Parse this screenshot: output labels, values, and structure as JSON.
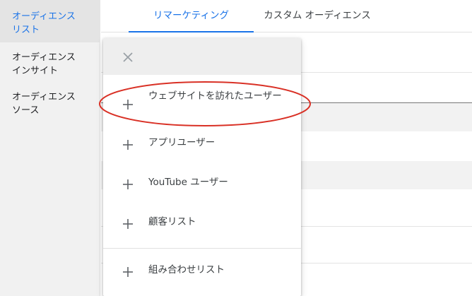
{
  "sidebar": {
    "items": [
      {
        "lines": [
          "オーディエンス",
          "リスト"
        ],
        "active": true
      },
      {
        "lines": [
          "オーディエンス",
          "インサイト"
        ],
        "active": false
      },
      {
        "lines": [
          "オーディエンス",
          "ソース"
        ],
        "active": false
      }
    ]
  },
  "tabs": [
    {
      "label": "リマーケティング",
      "active": true
    },
    {
      "label": "カスタム オーディエンス",
      "active": false
    }
  ],
  "menu": {
    "close_icon": "close-icon",
    "items": [
      {
        "icon": "plus-icon",
        "label": "ウェブサイトを訪れたユーザー"
      },
      {
        "icon": "plus-icon",
        "label": "アプリユーザー"
      },
      {
        "icon": "plus-icon",
        "label": "YouTube ユーザー"
      },
      {
        "icon": "plus-icon",
        "label": "顧客リスト"
      },
      {
        "icon": "plus-icon",
        "label": "組み合わせリスト"
      }
    ],
    "highlighted_item": "ウェブサイトを訪れたユーザー"
  },
  "colors": {
    "accent": "#1a73e8",
    "annotation": "#d93025",
    "sidebar_bg": "#f1f1f1",
    "menu_header_bg": "#eeeeee"
  }
}
